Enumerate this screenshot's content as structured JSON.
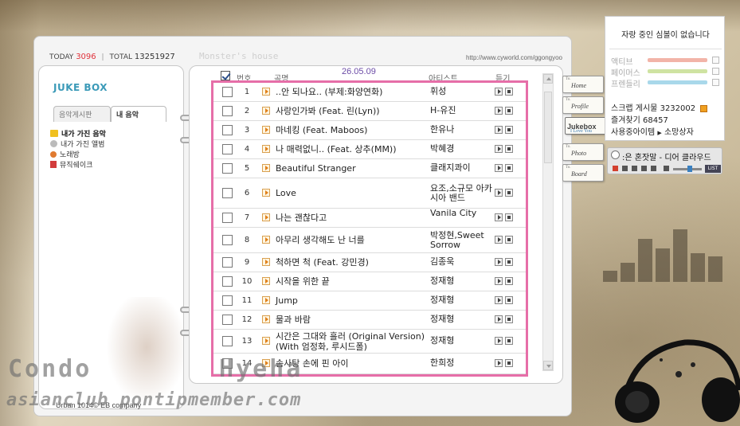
{
  "counter": {
    "today_label": "TODAY",
    "today_value": "3096",
    "total_label": "TOTAL",
    "total_value": "13251927"
  },
  "page_title": "Monster's house",
  "url": "http://www.cyworld.com/ggongyoo",
  "date": "26.05.09",
  "jukebox": {
    "title": "JUKE BOX",
    "tabs": [
      {
        "label": "음악게시판"
      },
      {
        "label": "내 음악"
      }
    ],
    "menu": [
      {
        "label": "내가 가진 음악"
      },
      {
        "label": "내가 가진 앨범"
      },
      {
        "label": "노래방"
      },
      {
        "label": "뮤직쉐이크"
      }
    ]
  },
  "playlist": {
    "headers": {
      "number": "번호",
      "title": "곡명",
      "artist": "아티스트",
      "listen": "듣기"
    },
    "rows": [
      {
        "num": "1",
        "title": "..안 되나요.. (부제:화양연화)",
        "artist": "휘성"
      },
      {
        "num": "2",
        "title": "사랑인가봐 (Feat. 린(Lyn))",
        "artist": "H-유진"
      },
      {
        "num": "3",
        "title": "마네킹 (Feat. Maboos)",
        "artist": "한유나"
      },
      {
        "num": "4",
        "title": "나 매력없니.. (Feat. 상추(MM))",
        "artist": "박혜경"
      },
      {
        "num": "5",
        "title": "Beautiful Stranger",
        "artist": "클래지콰이"
      },
      {
        "num": "6",
        "title": "Love",
        "artist": "요조,소규모 아카시아 밴드"
      },
      {
        "num": "7",
        "title": "나는 괜찮다고",
        "artist": "Vanila City"
      },
      {
        "num": "8",
        "title": "아무리 생각해도 난 너를",
        "artist": "박정현,Sweet Sorrow"
      },
      {
        "num": "9",
        "title": "척하면 척 (Feat. 강민경)",
        "artist": "김종욱"
      },
      {
        "num": "10",
        "title": "시작을 위한 끝",
        "artist": "정재형"
      },
      {
        "num": "11",
        "title": "Jump",
        "artist": "정재형"
      },
      {
        "num": "12",
        "title": "물과 바람",
        "artist": "정재형"
      },
      {
        "num": "13",
        "title": "시간은 그대와 흘러 (Original Version) (With 엄정화, 루시드폴)",
        "artist": "정재형"
      },
      {
        "num": "14",
        "title": "솜사탕 손에 핀 아이",
        "artist": "한희정"
      }
    ]
  },
  "nav_tags": [
    {
      "to": "To.",
      "label": "Home"
    },
    {
      "to": "To.",
      "label": "Profile"
    },
    {
      "to": "",
      "label": "Jukebox",
      "sub": "I Love You"
    },
    {
      "to": "To.",
      "label": "Photo"
    },
    {
      "to": "To.",
      "label": "Board"
    }
  ],
  "side": {
    "message": "자랑 중인 심볼이 없습니다",
    "bars": [
      {
        "label": "액티브",
        "color": "#f2b4a8"
      },
      {
        "label": "페이머스",
        "color": "#cfe3a2"
      },
      {
        "label": "프렌들리",
        "color": "#a9d8ea"
      }
    ],
    "scrap_label": "스크랩 게시물",
    "scrap_value": "3232002",
    "favorites_label": "즐겨찾기",
    "favorites_value": "68457",
    "items_label": "사용중아이템",
    "wish_label": "소망상자",
    "arrow": "▶"
  },
  "player": {
    "now_playing": ":은 혼잣말 - 디어 클라우드",
    "list_label": "LIST"
  },
  "footer": "Urban 1014© EB company",
  "watermark": {
    "line1": "Condo",
    "line1b": "Hyeha",
    "line2": "asianclub pontipmember.com"
  }
}
